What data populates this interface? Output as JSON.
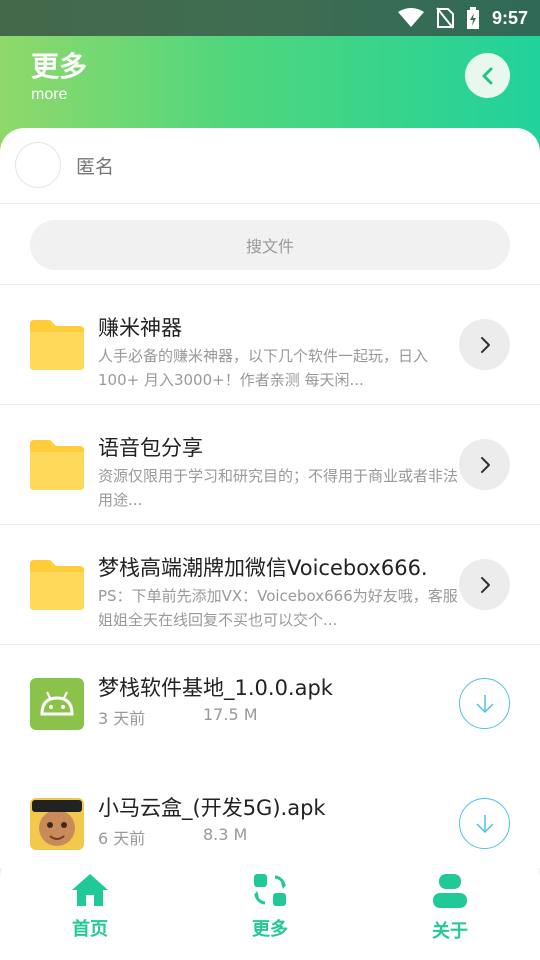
{
  "status_bar": {
    "time": "9:57"
  },
  "header": {
    "title": "更多",
    "subtitle": "more"
  },
  "user": {
    "name": "匿名"
  },
  "search": {
    "placeholder": "搜文件"
  },
  "folders": [
    {
      "title": "赚米神器",
      "desc": "人手必备的赚米神器，以下几个软件一起玩，日入100+ 月入3000+！作者亲测 每天闲..."
    },
    {
      "title": "语音包分享",
      "desc": "资源仅限用于学习和研究目的；不得用于商业或者非法用途..."
    },
    {
      "title": "梦栈高端潮牌加微信Voicebox666.",
      "desc": "PS：下单前先添加VX：Voicebox666为好友哦，客服姐姐全天在线回复不买也可以交个..."
    }
  ],
  "files": [
    {
      "title": "梦栈软件基地_1.0.0.apk",
      "time": "3 天前",
      "size": "17.5 M",
      "icon": "android-icon"
    },
    {
      "title": "小马云盒_(开发5G).apk",
      "time": "6 天前",
      "size": "8.3 M",
      "icon": "app-thumbnail"
    }
  ],
  "nav": [
    {
      "label": "首页",
      "icon": "home-icon"
    },
    {
      "label": "更多",
      "icon": "more-icon"
    },
    {
      "label": "关于",
      "icon": "user-icon"
    }
  ],
  "colors": {
    "accent": "#20c997",
    "folder": "#ffd54f",
    "download": "#4cc3e6"
  }
}
